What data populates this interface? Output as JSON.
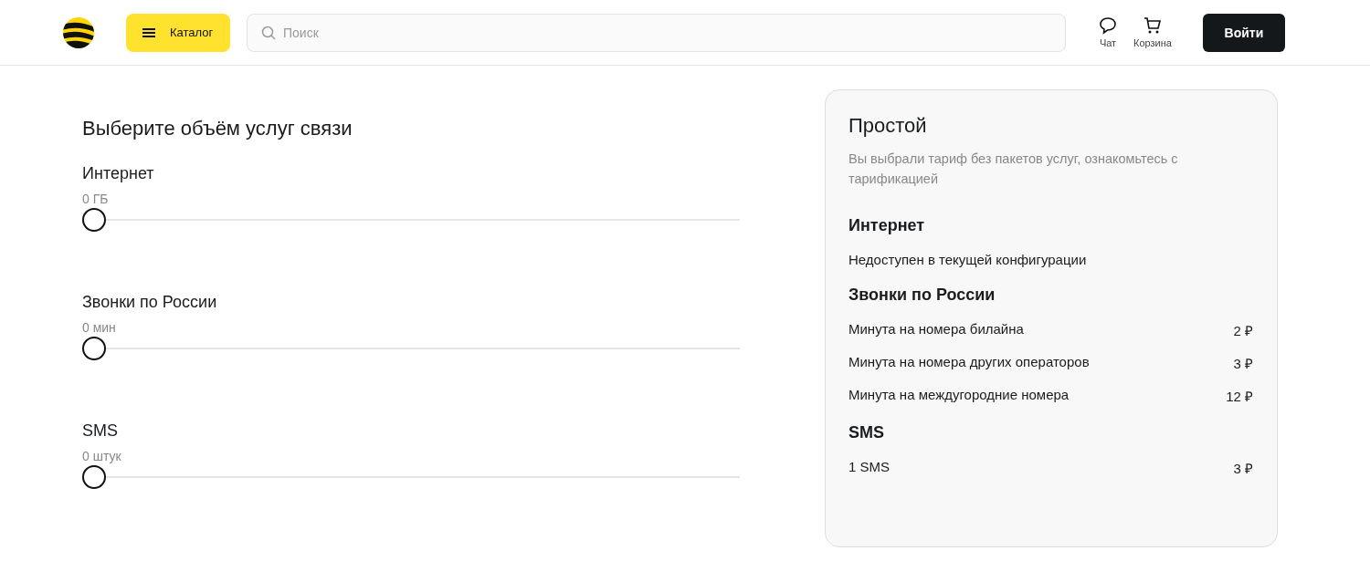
{
  "header": {
    "catalog_button": "Каталог",
    "search": {
      "placeholder": "Поиск"
    },
    "actions": [
      {
        "kind": "chat",
        "label": "Чат"
      },
      {
        "kind": "cart",
        "label": "Корзина"
      }
    ],
    "login_button": "Войти"
  },
  "configurator": {
    "title": "Выберите объём услуг связи",
    "sliders": [
      {
        "name": "Интернет",
        "reading": "0 ГБ",
        "level": 0
      },
      {
        "name": "Звонки по России",
        "reading": "0 мин",
        "level": 0
      },
      {
        "name": "SMS",
        "reading": "0 штук",
        "level": 0
      }
    ]
  },
  "summary": {
    "title": "Простой",
    "description": "Вы выбрали тариф без пакетов услуг, ознакомьтесь с тарификацией",
    "sections": [
      {
        "title": "Интернет",
        "note": "Недоступен в текущей конфигурации"
      },
      {
        "title": "Звонки по России",
        "rows": [
          {
            "label": "Минута на номера билайна",
            "price": "2 ₽"
          },
          {
            "label": "Минута на номера других операторов",
            "price": "3 ₽"
          },
          {
            "label": "Минута на междугородние номера",
            "price": "12 ₽"
          }
        ]
      },
      {
        "title": "SMS",
        "rows": [
          {
            "label": "1 SMS",
            "price": "3 ₽"
          }
        ]
      }
    ]
  }
}
